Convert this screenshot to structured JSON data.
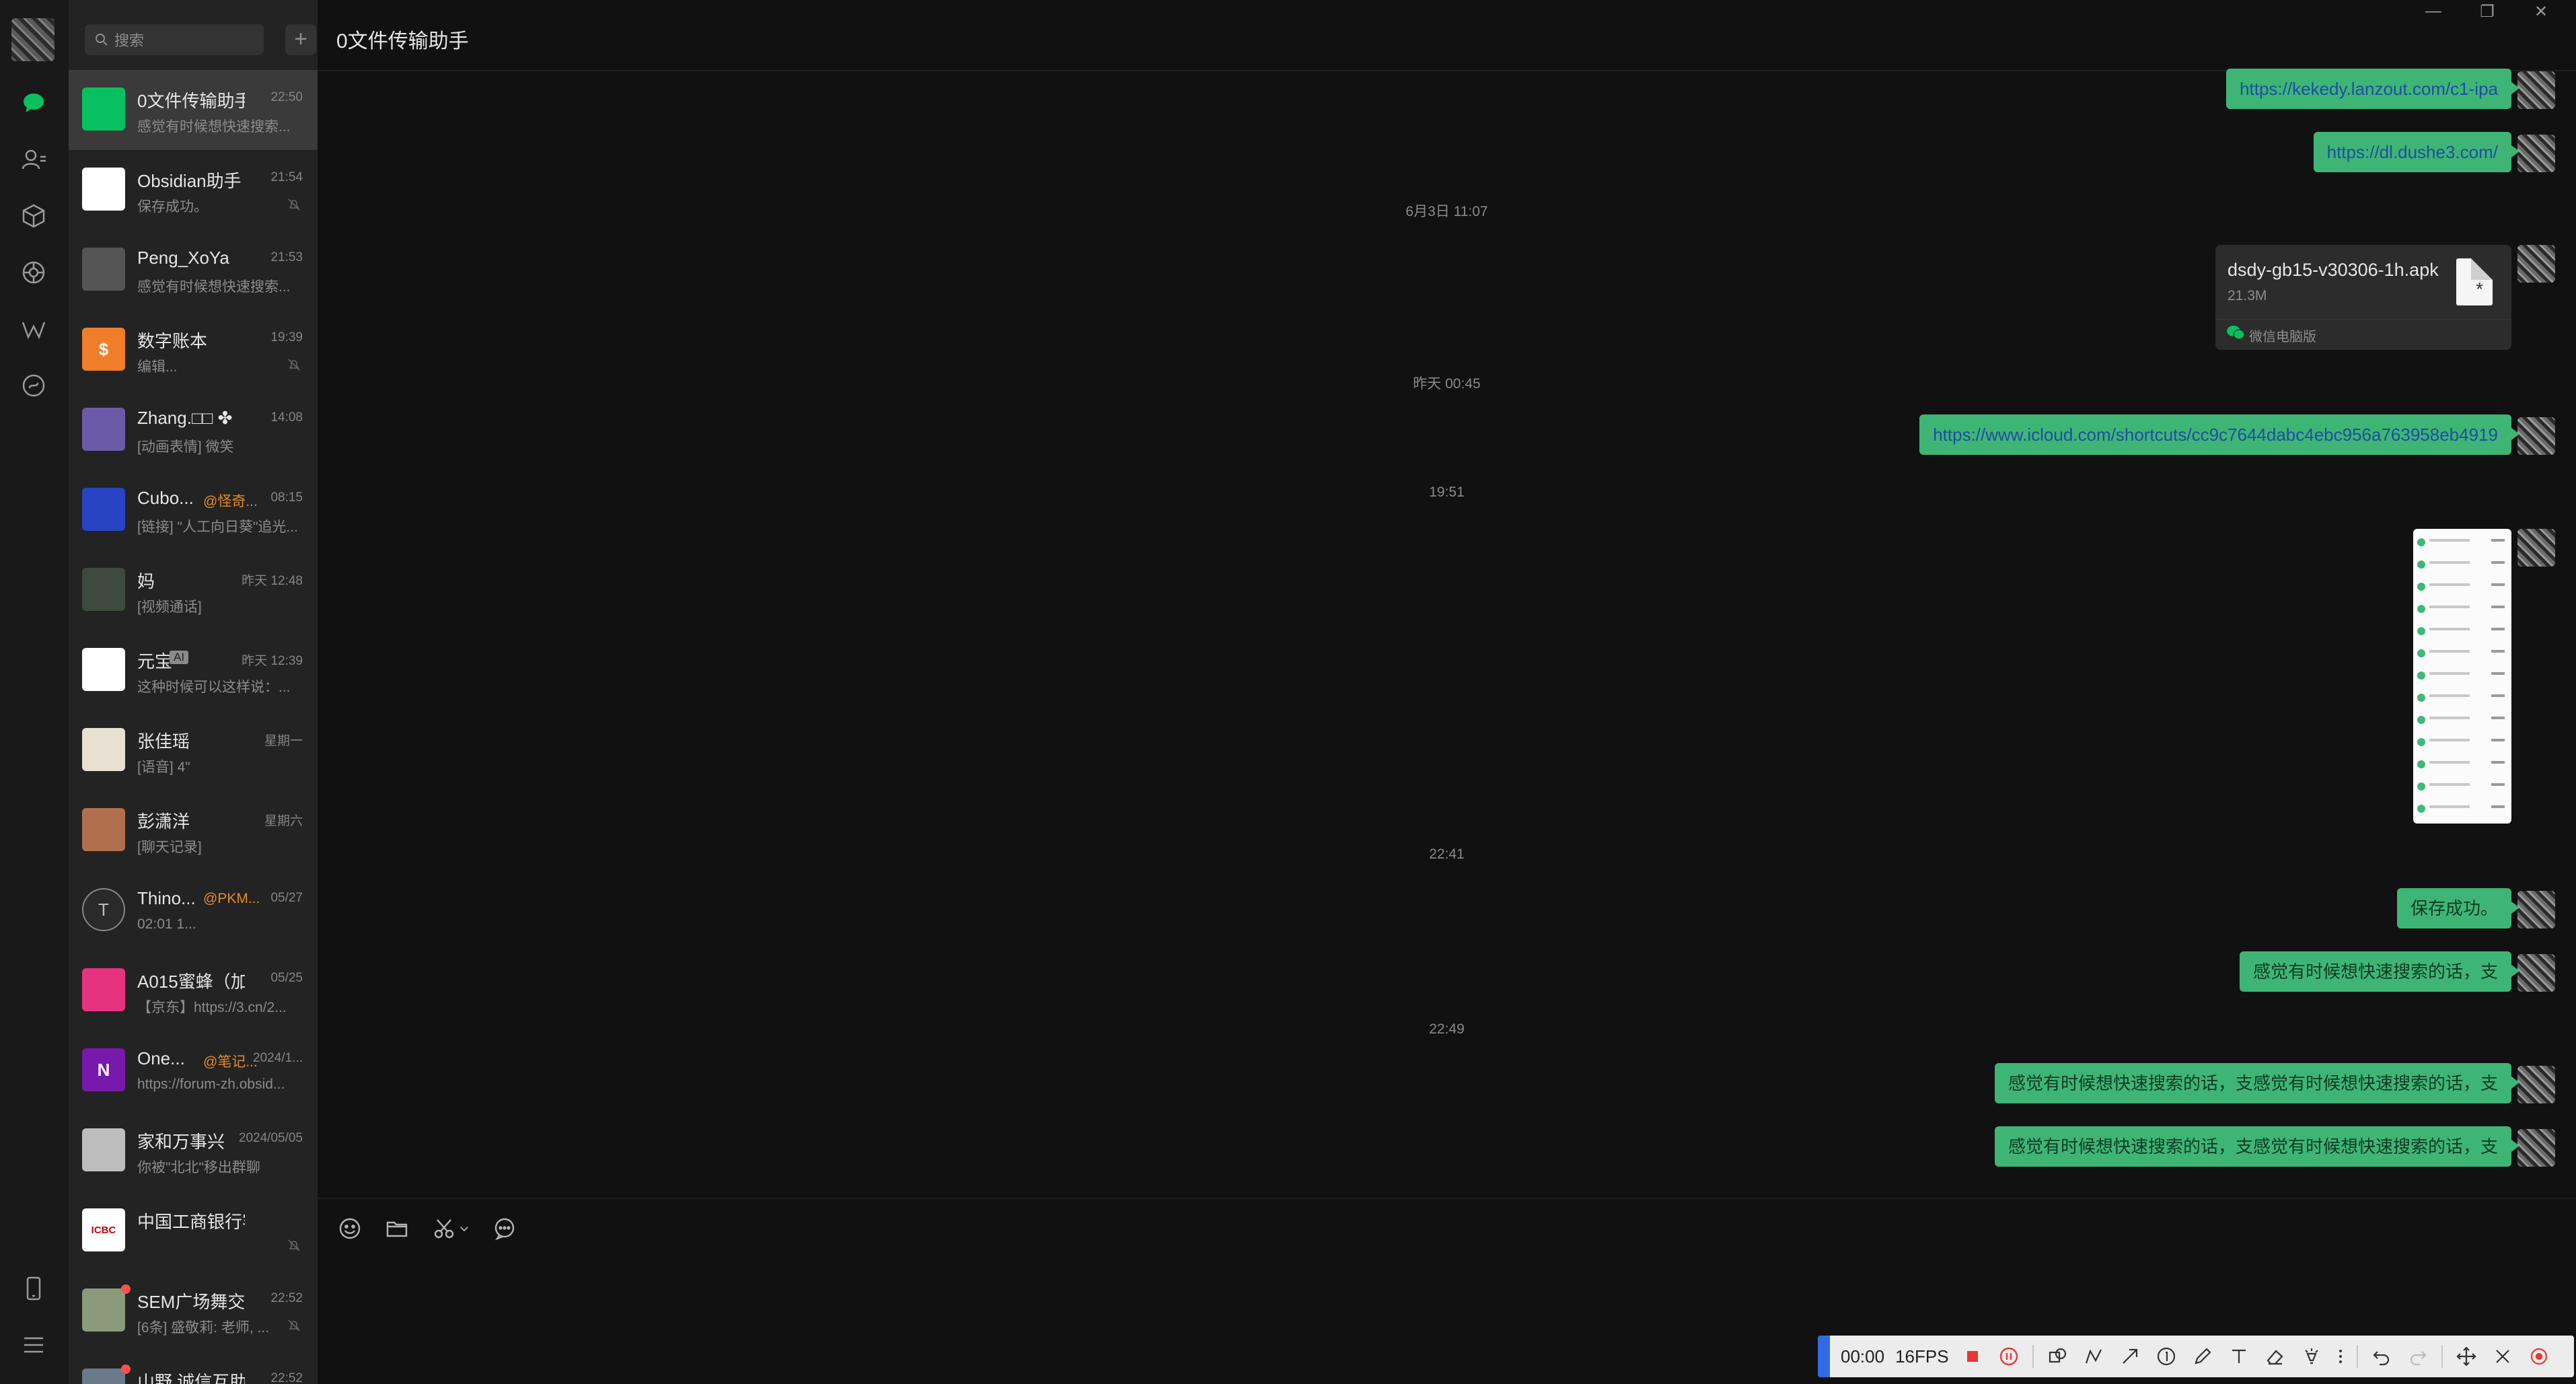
{
  "rail": {
    "icons": [
      "chat-icon",
      "contacts-icon",
      "favorites-icon",
      "moments-icon",
      "channels-icon",
      "mini-programs-icon",
      "phone-icon",
      "menu-icon"
    ]
  },
  "search": {
    "placeholder": "搜索",
    "add_label": "+"
  },
  "sessions": [
    {
      "name": "0文件传输助手",
      "time": "22:50",
      "preview": "感觉有时候想快速搜索...",
      "avatar_color": "#07c160",
      "avatar_text": "",
      "muted": false,
      "active": true
    },
    {
      "name": "Obsidian助手",
      "time": "21:54",
      "preview": "保存成功。",
      "avatar_color": "#ffffff",
      "avatar_text": "",
      "muted": true
    },
    {
      "name": "Peng_XoYa",
      "time": "21:53",
      "preview": "感觉有时候想快速搜索...",
      "avatar_color": "#555555",
      "avatar_text": "",
      "muted": false
    },
    {
      "name": "数字账本",
      "time": "19:39",
      "preview": "编辑...",
      "avatar_color": "#f07d2a",
      "avatar_text": "$",
      "muted": true
    },
    {
      "name": "Zhanɡ.□□ ✤",
      "time": "14:08",
      "preview": "[动画表情] 微笑",
      "avatar_color": "#6b5aa8",
      "avatar_text": "",
      "muted": false
    },
    {
      "name": "Cubo...",
      "tag": "@怪奇...",
      "time": "08:15",
      "preview": "[链接] \"人工向日葵\"追光...",
      "avatar_color": "#2843c4",
      "avatar_text": "",
      "muted": false
    },
    {
      "name": "妈",
      "time": "昨天 12:48",
      "preview": "[视频通话]",
      "avatar_color": "#3d4a3d",
      "avatar_text": "",
      "muted": false
    },
    {
      "name": "元宝",
      "tag": "AI",
      "time": "昨天 12:39",
      "preview": "这种时候可以这样说：...",
      "avatar_color": "#ffffff",
      "avatar_text": "",
      "muted": false
    },
    {
      "name": "张佳瑶",
      "time": "星期一",
      "preview": "[语音] 4\"",
      "avatar_color": "#e8e0d0",
      "avatar_text": "",
      "muted": false
    },
    {
      "name": "彭潇洋",
      "time": "星期六",
      "preview": "[聊天记录]",
      "avatar_color": "#b07050",
      "avatar_text": "",
      "muted": false
    },
    {
      "name": "Thino...",
      "tag": "@PKM...",
      "time": "05/27",
      "preview": "02:01 1...",
      "avatar_color": "#2a2a2a",
      "avatar_text": "T",
      "muted": false
    },
    {
      "name": "A015蜜蜂（加...",
      "time": "05/25",
      "preview": "【京东】https://3.cn/2...",
      "avatar_color": "#e63380",
      "avatar_text": "",
      "muted": false
    },
    {
      "name": "One...",
      "tag": "@笔记...",
      "time": "2024/1...",
      "preview": "https://forum-zh.obsid...",
      "avatar_color": "#ffffff",
      "avatar_text": "N",
      "muted": false
    },
    {
      "name": "家和万事兴",
      "time": "2024/05/05",
      "preview": "你被\"北北\"移出群聊",
      "avatar_color": "#bdbdbd",
      "avatar_text": "",
      "muted": false
    },
    {
      "name": "中国工商银行客户...",
      "time": "",
      "preview": "",
      "avatar_color": "#ffffff",
      "avatar_text": "ICBC",
      "muted": true
    },
    {
      "name": "SEM广场舞交...",
      "time": "22:52",
      "preview": "[6条] 盛敬莉: 老师, ...",
      "avatar_color": "#8a9a7a",
      "avatar_text": "",
      "muted": true,
      "dot": true
    },
    {
      "name": "山野 诚信互助群",
      "time": "22:52",
      "preview": "",
      "avatar_color": "#6a7a8a",
      "avatar_text": "",
      "muted": false,
      "dot": true
    }
  ],
  "chat": {
    "title": "0文件传输助手",
    "window_controls": [
      "—",
      "❐",
      "✕"
    ],
    "messages": {
      "link1": "https://kekedy.lanzout.com/c1-ipa",
      "link2": "https://dl.dushe3.com/",
      "ts1": "6月3日 11:07",
      "file": {
        "name": "dsdy-gb15-v30306-1h.apk",
        "size": "21.3M",
        "source": "微信电脑版"
      },
      "ts2": "昨天 00:45",
      "link3": "https://www.icloud.com/shortcuts/cc9c7644dabc4ebc956a763958eb4919",
      "ts3": "19:51",
      "ts4": "22:41",
      "msg_saved": "保存成功。",
      "msg_search1": "感觉有时候想快速搜索的话，支",
      "ts5": "22:49",
      "msg_search2": "感觉有时候想快速搜索的话，支感觉有时候想快速搜索的话，支",
      "msg_search3": "感觉有时候想快速搜索的话，支感觉有时候想快速搜索的话，支"
    }
  },
  "input_tools": [
    "emoji-icon",
    "folder-icon",
    "scissors-icon",
    "chat-history-icon"
  ],
  "recorder": {
    "time": "00:00",
    "fps": "16FPS"
  }
}
